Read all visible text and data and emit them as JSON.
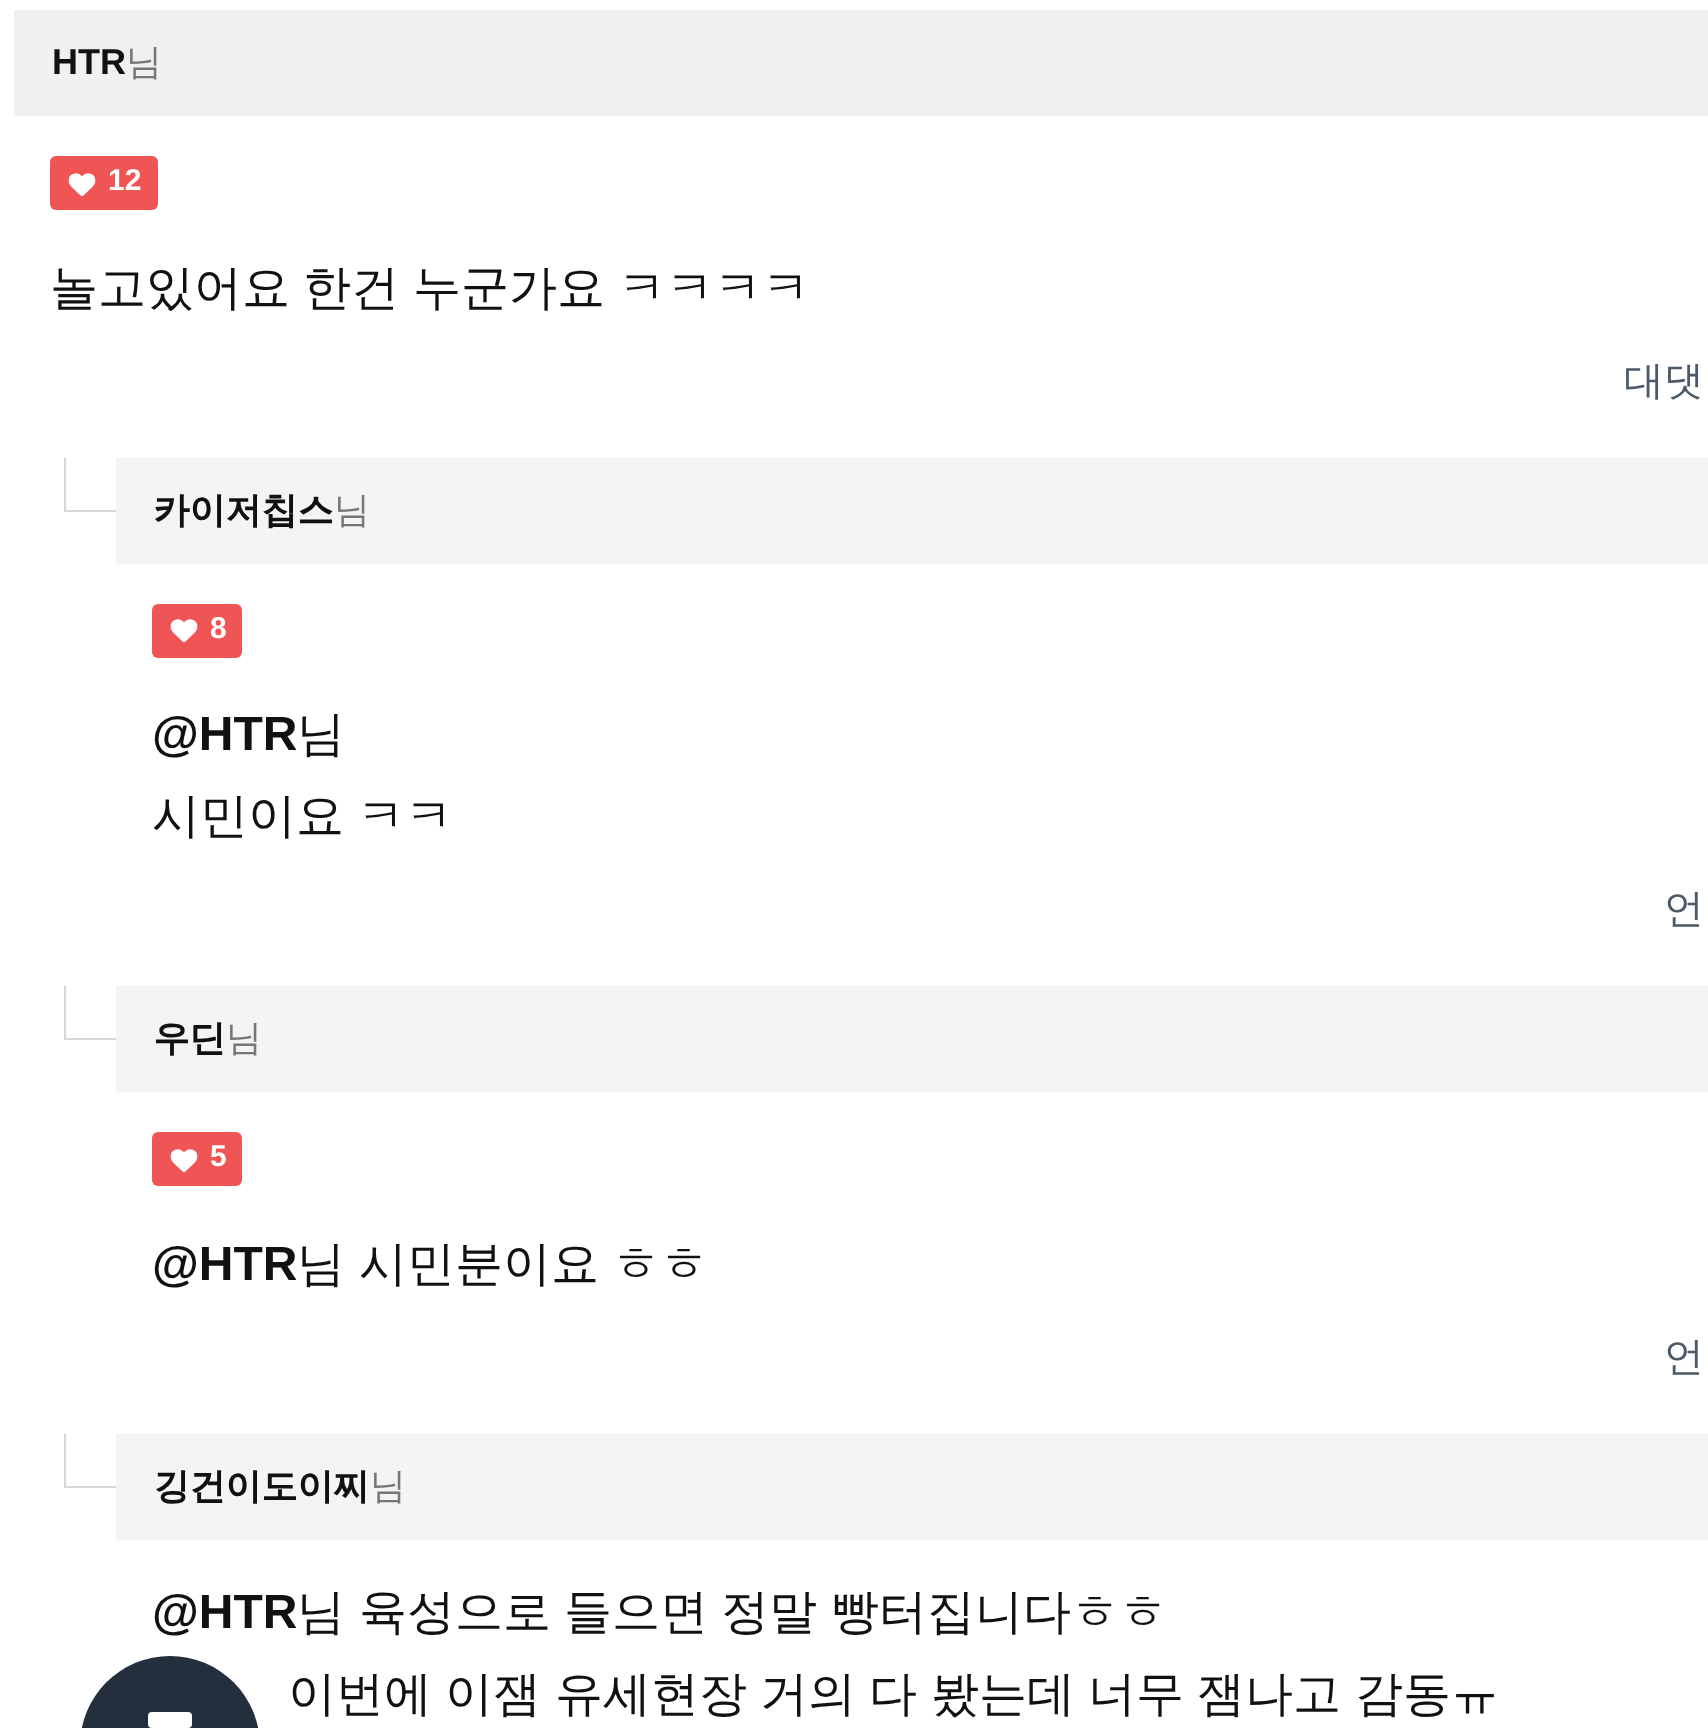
{
  "comments": [
    {
      "author": "HTR",
      "suffix": "님",
      "likes": "12",
      "lines": [
        "놀고있어요 한건 누군가요 ㅋㅋㅋㅋ"
      ],
      "action": "대댓",
      "replies": [
        {
          "author": "카이저칩스",
          "suffix": "님",
          "likes": "8",
          "lines": [
            "**@HTR**님",
            "시민이요 ㅋㅋ"
          ],
          "action": "언"
        },
        {
          "author": "우딘",
          "suffix": "님",
          "likes": "5",
          "lines": [
            "**@HTR**님 시민분이요 ㅎㅎ"
          ],
          "action": "언"
        },
        {
          "author": "깅건이도이찌",
          "suffix": "님",
          "lines": [
            "**@HTR**님 육성으로 들으면 정말 빵터집니다ㅎㅎ",
            {
              "kind": "partly_hidden",
              "text": "이번에 이잼 유세현장 거의 다 봤는데 너무 잼나고 감동ㅠ"
            }
          ]
        }
      ]
    }
  ]
}
